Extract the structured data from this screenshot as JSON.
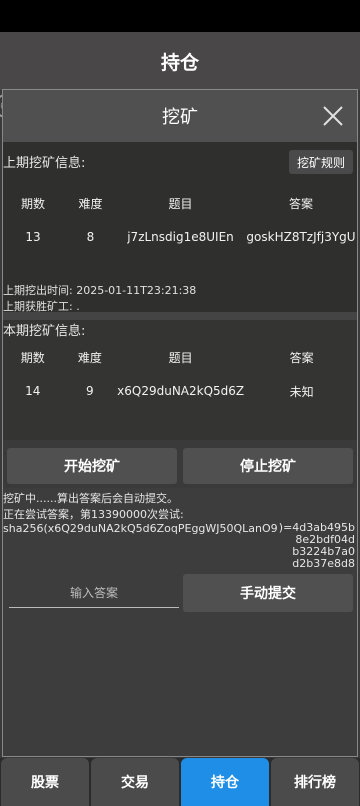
{
  "app": {
    "title": "持仓"
  },
  "dialog": {
    "title": "挖矿",
    "rules_button": "挖矿规则",
    "prev": {
      "label": "上期挖矿信息:",
      "headers": [
        "期数",
        "难度",
        "题目",
        "答案"
      ],
      "row": [
        "13",
        "8",
        "j7zLnsdig1e8UIEn",
        "goskHZ8TzJfj3YgU"
      ],
      "time_label": "上期挖出时间:",
      "time_value": "2025-01-11T23:21:38",
      "miner_label": "上期获胜矿工:",
      "miner_value": "."
    },
    "current": {
      "label": "本期挖矿信息:",
      "headers": [
        "期数",
        "难度",
        "题目",
        "答案"
      ],
      "row": [
        "14",
        "9",
        "x6Q29duNA2kQ5d6Z",
        "未知"
      ]
    },
    "start_button": "开始挖矿",
    "stop_button": "停止挖矿",
    "log": {
      "line1": "挖矿中......算出答案后会自动提交。",
      "line2": "正在尝试答案，第13390000次尝试:",
      "line3": "sha256(x6Q29duNA2kQ5d6ZoqPEggWJ50QLanO9",
      "hash1": ")=4d3ab495b",
      "hash2": "8e2bdf04d",
      "hash3": "b3224b7a0",
      "hash4": "d2b37e8d8"
    },
    "answer_placeholder": "输入答案",
    "submit_button": "手动提交"
  },
  "nav": [
    {
      "label": "股票"
    },
    {
      "label": "交易"
    },
    {
      "label": "持仓"
    },
    {
      "label": "排行榜"
    }
  ],
  "colors": {
    "active_tab": "#1e8ee6",
    "dialog_bg": "#3d3d3d",
    "header_bg": "#4a4748"
  }
}
